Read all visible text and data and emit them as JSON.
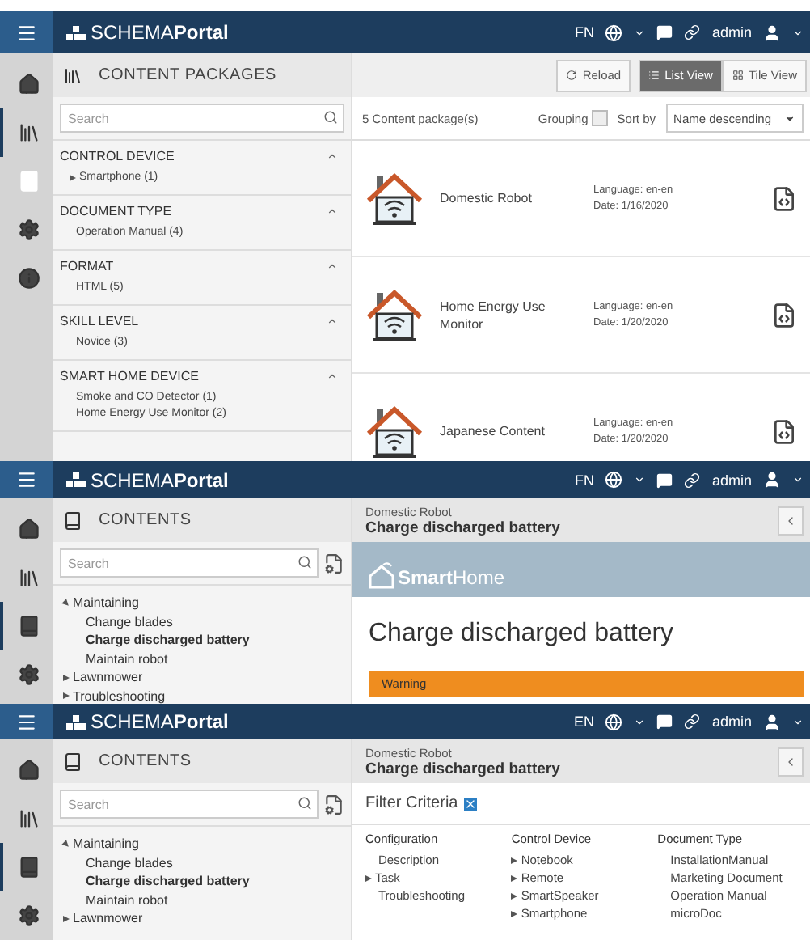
{
  "screens": [
    {
      "kind": "packages",
      "header": {
        "brand_light": "SCHEMA",
        "brand_bold": "Portal",
        "language": "FN",
        "user": "admin"
      },
      "nav": [
        {
          "selected": false
        },
        {
          "selected": true
        },
        {
          "selected": false
        },
        {
          "selected": false
        },
        {
          "selected": false
        }
      ],
      "left": {
        "title": "CONTENT PACKAGES",
        "search": {
          "placeholder": "Search"
        },
        "facets": [
          {
            "title": "CONTROL DEVICE",
            "expanded": true,
            "items": [
              {
                "label": "Smartphone (1)",
                "expandable": true
              }
            ]
          },
          {
            "title": "DOCUMENT TYPE",
            "expanded": true,
            "items": [
              {
                "label": "Operation Manual (4)",
                "expandable": false
              }
            ]
          },
          {
            "title": "FORMAT",
            "expanded": true,
            "items": [
              {
                "label": "HTML (5)",
                "expandable": false
              }
            ]
          },
          {
            "title": "SKILL LEVEL",
            "expanded": true,
            "items": [
              {
                "label": "Novice (3)",
                "expandable": false
              }
            ]
          },
          {
            "title": "SMART HOME DEVICE",
            "expanded": true,
            "items": [
              {
                "label": "Smoke and CO Detector (1)",
                "expandable": false
              },
              {
                "label": "Home Energy Use Monitor (2)",
                "expandable": false
              }
            ]
          }
        ]
      },
      "right": {
        "reload": "Reload",
        "views": [
          {
            "label": "List View",
            "kind": "list",
            "selected": true
          },
          {
            "label": "Tile View",
            "kind": "tile",
            "selected": false
          }
        ],
        "count": "5 Content package(s)",
        "grouping": {
          "label": "Grouping",
          "checked": false
        },
        "sort_label": "Sort by",
        "sort_value": "Name descending",
        "packages": [
          {
            "name": "Domestic Robot",
            "language": "Language: en-en",
            "date": "Date: 1/16/2020"
          },
          {
            "name": "Home Energy Use Monitor",
            "language": "Language: en-en",
            "date": "Date: 1/20/2020"
          },
          {
            "name": "Japanese Content",
            "language": "Language: en-en",
            "date": "Date: 1/20/2020"
          }
        ]
      }
    },
    {
      "kind": "topic",
      "header": {
        "brand_light": "SCHEMA",
        "brand_bold": "Portal",
        "language": "FN",
        "user": "admin"
      },
      "nav": [
        {
          "selected": false
        },
        {
          "selected": false
        },
        {
          "selected": true
        },
        {
          "selected": false
        }
      ],
      "left": {
        "title": "CONTENTS",
        "search": {
          "placeholder": "Search"
        },
        "tree": [
          {
            "label": "Maintaining",
            "expanded": true,
            "selected": false,
            "children": [
              {
                "label": "Change blades",
                "selected": false
              },
              {
                "label": "Charge discharged battery",
                "selected": true
              },
              {
                "label": "Maintain robot",
                "selected": false
              }
            ]
          },
          {
            "label": "Lawnmower",
            "expanded": false,
            "selected": false
          },
          {
            "label": "Troubleshooting",
            "expanded": false,
            "selected": false
          }
        ]
      },
      "right": {
        "breadcrumb": "Domestic Robot",
        "title": "Charge discharged battery",
        "banner_bold": "Smart",
        "banner_light": "Home",
        "heading": "Charge discharged battery",
        "warning": "Warning"
      }
    },
    {
      "kind": "filter",
      "header": {
        "brand_light": "SCHEMA",
        "brand_bold": "Portal",
        "language": "EN",
        "user": "admin"
      },
      "nav": [
        {
          "selected": false
        },
        {
          "selected": false
        },
        {
          "selected": true
        },
        {
          "selected": false
        }
      ],
      "left": {
        "title": "CONTENTS",
        "search": {
          "placeholder": "Search"
        },
        "tree": [
          {
            "label": "Maintaining",
            "expanded": true,
            "selected": false,
            "children": [
              {
                "label": "Change blades",
                "selected": false
              },
              {
                "label": "Charge discharged battery",
                "selected": true
              },
              {
                "label": "Maintain robot",
                "selected": false
              }
            ]
          },
          {
            "label": "Lawnmower",
            "expanded": false,
            "selected": false
          }
        ]
      },
      "right": {
        "breadcrumb": "Domestic Robot",
        "title": "Charge discharged battery",
        "filter_title": "Filter Criteria",
        "columns": [
          {
            "heading": "Configuration",
            "items": [
              {
                "label": "Description",
                "expandable": false
              },
              {
                "label": "Task",
                "expandable": true
              },
              {
                "label": "Troubleshooting",
                "expandable": false
              }
            ]
          },
          {
            "heading": "Control Device",
            "items": [
              {
                "label": "Notebook",
                "expandable": true
              },
              {
                "label": "Remote",
                "expandable": true
              },
              {
                "label": "SmartSpeaker",
                "expandable": true
              },
              {
                "label": "Smartphone",
                "expandable": true
              }
            ]
          },
          {
            "heading": "Document Type",
            "items": [
              {
                "label": "InstallationManual",
                "expandable": false
              },
              {
                "label": "Marketing Document",
                "expandable": false
              },
              {
                "label": "Operation Manual",
                "expandable": false
              },
              {
                "label": "microDoc",
                "expandable": false
              }
            ]
          }
        ]
      }
    }
  ]
}
